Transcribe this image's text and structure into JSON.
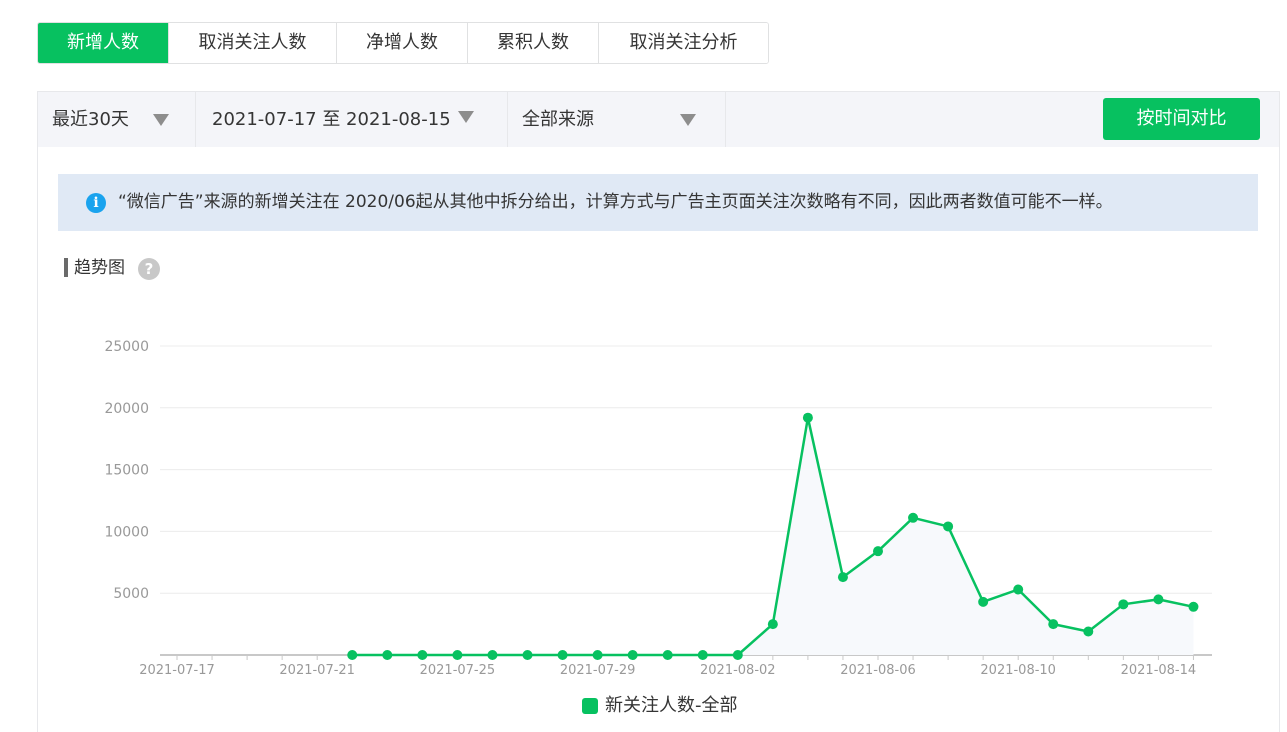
{
  "tabs": [
    {
      "label": "新增人数",
      "active": true
    },
    {
      "label": "取消关注人数",
      "active": false
    },
    {
      "label": "净增人数",
      "active": false
    },
    {
      "label": "累积人数",
      "active": false
    },
    {
      "label": "取消关注分析",
      "active": false
    }
  ],
  "filters": {
    "range": "最近30天",
    "dates": "2021-07-17 至 2021-08-15",
    "source": "全部来源",
    "compare_button": "按时间对比"
  },
  "notice": {
    "icon": "info-icon",
    "text": "“微信广告”来源的新增关注在 2020/06起从其他中拆分给出，计算方式与广告主页面关注次数略有不同，因此两者数值可能不一样。"
  },
  "trend": {
    "title": "趋势图",
    "help": "?"
  },
  "colors": {
    "accent": "#07c160",
    "notice_bg": "#e0e9f5",
    "info": "#1aa3ee"
  },
  "chart_data": {
    "type": "line",
    "title": "",
    "xlabel": "",
    "ylabel": "",
    "x": [
      "2021-07-17",
      "2021-07-18",
      "2021-07-19",
      "2021-07-20",
      "2021-07-21",
      "2021-07-22",
      "2021-07-23",
      "2021-07-24",
      "2021-07-25",
      "2021-07-26",
      "2021-07-27",
      "2021-07-28",
      "2021-07-29",
      "2021-07-30",
      "2021-07-31",
      "2021-08-01",
      "2021-08-02",
      "2021-08-03",
      "2021-08-04",
      "2021-08-05",
      "2021-08-06",
      "2021-08-07",
      "2021-08-08",
      "2021-08-09",
      "2021-08-10",
      "2021-08-11",
      "2021-08-12",
      "2021-08-13",
      "2021-08-14",
      "2021-08-15"
    ],
    "x_ticks": [
      "2021-07-17",
      "2021-07-21",
      "2021-07-25",
      "2021-07-29",
      "2021-08-02",
      "2021-08-06",
      "2021-08-10",
      "2021-08-14"
    ],
    "y_ticks": [
      5000,
      10000,
      15000,
      20000,
      25000
    ],
    "ylim": [
      0,
      25000
    ],
    "grid": true,
    "legend_position": "bottom-center",
    "series": [
      {
        "name": "新关注人数-全部",
        "color": "#07c160",
        "values": [
          null,
          null,
          null,
          null,
          null,
          0,
          0,
          0,
          0,
          0,
          0,
          0,
          0,
          0,
          0,
          0,
          0,
          2500,
          19200,
          6300,
          8400,
          11100,
          10400,
          4300,
          5300,
          2500,
          1900,
          4100,
          4500,
          3900
        ]
      }
    ]
  }
}
